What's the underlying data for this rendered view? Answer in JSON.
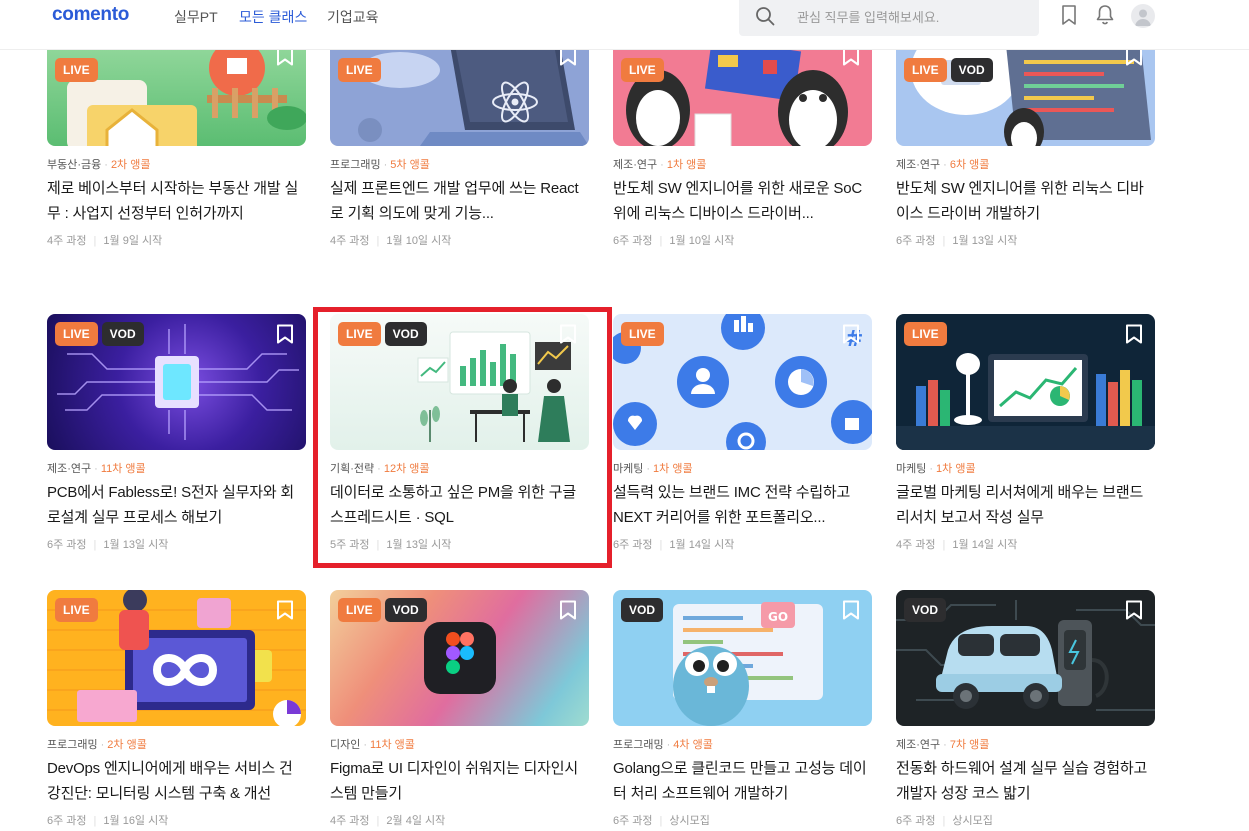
{
  "header": {
    "logo": "comento",
    "nav": [
      "실무PT",
      "모든 클래스",
      "기업교육"
    ],
    "active_nav": "모든 클래스",
    "search_placeholder": "관심 직무를 입력해보세요."
  },
  "cards": [
    {
      "category": "부동산·금융",
      "cohort": "2차 앵콜",
      "title": "제로 베이스부터 시작하는 부동산 개발 실무 : 사업지 선정부터 인허가까지",
      "duration": "4주 과정",
      "start": "1월 9일 시작",
      "badges": [
        "LIVE"
      ],
      "bg": "#5bbd72"
    },
    {
      "category": "프로그래밍",
      "cohort": "5차 앵콜",
      "title": "실제 프론트엔드 개발 업무에 쓰는 React로 기획 의도에 맞게 기능...",
      "duration": "4주 과정",
      "start": "1월 10일 시작",
      "badges": [
        "LIVE"
      ],
      "bg": "#8ea3d6"
    },
    {
      "category": "제조·연구",
      "cohort": "1차 앵콜",
      "title": "반도체 SW 엔지니어를 위한 새로운 SoC 위에 리눅스 디바이스 드라이버...",
      "duration": "6주 과정",
      "start": "1월 10일 시작",
      "badges": [
        "LIVE"
      ],
      "bg": "#f27b93"
    },
    {
      "category": "제조·연구",
      "cohort": "6차 앵콜",
      "title": "반도체 SW 엔지니어를 위한 리눅스 디바이스 드라이버 개발하기",
      "duration": "6주 과정",
      "start": "1월 13일 시작",
      "badges": [
        "LIVE",
        "VOD"
      ],
      "bg": "#a9c6f0"
    },
    {
      "category": "제조·연구",
      "cohort": "11차 앵콜",
      "title": "PCB에서 Fabless로! S전자 실무자와 회로설계 실무 프로세스 해보기",
      "duration": "6주 과정",
      "start": "1월 13일 시작",
      "badges": [
        "LIVE",
        "VOD"
      ],
      "bg": "#2a1a7a"
    },
    {
      "category": "기획·전략",
      "cohort": "12차 앵콜",
      "title": "데이터로 소통하고 싶은 PM을 위한 구글 스프레드시트 · SQL",
      "duration": "5주 과정",
      "start": "1월 13일 시작",
      "badges": [
        "LIVE",
        "VOD"
      ],
      "bg": "#e4f2ec"
    },
    {
      "category": "마케팅",
      "cohort": "1차 앵콜",
      "title": "설득력 있는 브랜드 IMC 전략 수립하고 NEXT 커리어를 위한 포트폴리오...",
      "duration": "6주 과정",
      "start": "1월 14일 시작",
      "badges": [
        "LIVE"
      ],
      "bg": "#dce9fb"
    },
    {
      "category": "마케팅",
      "cohort": "1차 앵콜",
      "title": "글로벌 마케팅 리서쳐에게 배우는 브랜드 리서치 보고서 작성 실무",
      "duration": "4주 과정",
      "start": "1월 14일 시작",
      "badges": [
        "LIVE"
      ],
      "bg": "#0f2538"
    },
    {
      "category": "프로그래밍",
      "cohort": "2차 앵콜",
      "title": "DevOps 엔지니어에게 배우는 서비스 건강진단: 모니터링 시스템 구축 & 개선",
      "duration": "6주 과정",
      "start": "1월 16일 시작",
      "badges": [
        "LIVE"
      ],
      "bg": "#ffb21f"
    },
    {
      "category": "디자인",
      "cohort": "11차 앵콜",
      "title": "Figma로 UI 디자인이 쉬워지는 디자인시스템 만들기",
      "duration": "4주 과정",
      "start": "2월 4일 시작",
      "badges": [
        "LIVE",
        "VOD"
      ],
      "bg": "#ef8f7a"
    },
    {
      "category": "프로그래밍",
      "cohort": "4차 앵콜",
      "title": "Golang으로 클린코드 만들고 고성능 데이터 처리 소프트웨어 개발하기",
      "duration": "6주 과정",
      "start": "상시모집",
      "badges": [
        "VOD"
      ],
      "bg": "#8fd0f2"
    },
    {
      "category": "제조·연구",
      "cohort": "7차 앵콜",
      "title": "전동화 하드웨어 설계 실무 실습 경험하고 개발자 성장 코스 밟기",
      "duration": "6주 과정",
      "start": "상시모집",
      "badges": [
        "VOD"
      ],
      "bg": "#1e2326"
    }
  ]
}
